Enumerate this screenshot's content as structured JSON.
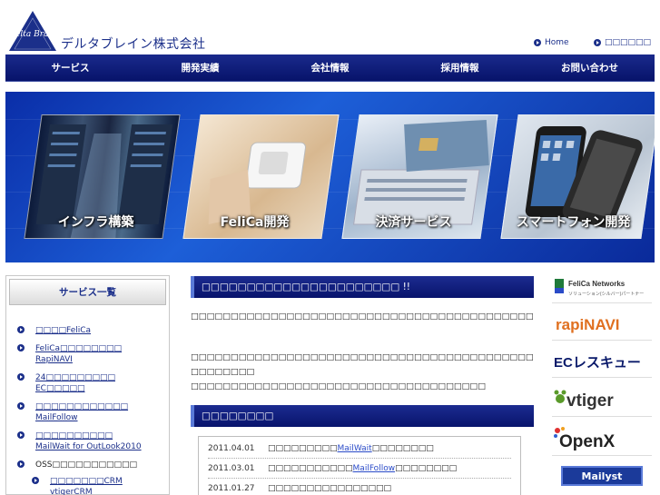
{
  "header": {
    "logo_text": "Delta Brain",
    "company_name": "デルタブレイン株式会社",
    "top_links": [
      "Home",
      "□□□□□□"
    ]
  },
  "nav": {
    "items": [
      "サービス",
      "開発実績",
      "会社情報",
      "採用情報",
      "お問い合わせ"
    ]
  },
  "banner": {
    "panels": [
      "インフラ構築",
      "FeliCa開発",
      "決済サービス",
      "スマートフォン開発"
    ]
  },
  "sidebar": {
    "title": "サービス一覧",
    "items": [
      {
        "line1": "□□□□FeliCa",
        "line2": ""
      },
      {
        "line1": "FeliCa□□□□□□□□",
        "line2": "RapiNAVI"
      },
      {
        "line1": "24□□□□□□□□□",
        "line2": "EC□□□□□"
      },
      {
        "line1": "□□□□□□□□□□□□",
        "line2": "MailFollow"
      },
      {
        "line1": "□□□□□□□□□□",
        "line2": "MailWait for OutLook2010"
      },
      {
        "line1": "OSS□□□□□□□□□□□",
        "line2": ""
      },
      {
        "line1": "□□□□□□□CRM",
        "line2": "vtigerCRM"
      }
    ]
  },
  "main": {
    "heading": "□□□□□□□□□□□□□□□□□□□□□□ !!",
    "para1": "□□□□□□□□□□□□□□□□□□□□□□□□□□□□□□□□□□□□□□□□□□□□□□□□□□□□□□□□□□□□□□□□□□□□□□□□□□□□□□□□□□□□□□□□□□□□",
    "para2": "□□□□□□□□□□□□□□□□□□□□□□□□□□□□□□□□□□□□□□□□□□□□□□□□□□□□□□□□□□□□□□□□□□□□□ □□□□□□□□ □□□□□□□□□□□□□□□□□□□□□□□□□□□□□□□□□□□□□ □□□□□□□□□□□□□□□",
    "news_heading": "□□□□□□□□",
    "news": [
      {
        "date": "2011.04.01",
        "before": "□□□□□□□□□ ",
        "link": "MailWait",
        "after": " □□□□□□□□"
      },
      {
        "date": "2011.03.01",
        "before": "□□□□□□□□□□□ ",
        "link": "MailFollow",
        "after": " □□□□□□□□"
      },
      {
        "date": "2011.01.27",
        "before": "□□□□□□□□□□□□□□□□",
        "link": "",
        "after": ""
      }
    ]
  },
  "partners": {
    "felica_title": "FeliCa Networks",
    "felica_sub": "ソリューション(シルバー)パートナー",
    "rapinavi": "rapiNAVI",
    "ecrescue": "ECレスキュー",
    "vtiger": "vtiger",
    "openx": "OpenX",
    "mailyst": "Mailyst"
  },
  "colors": {
    "nav": "#0d1d7a",
    "banner": "#1450c8",
    "link": "#2a4bc8"
  }
}
